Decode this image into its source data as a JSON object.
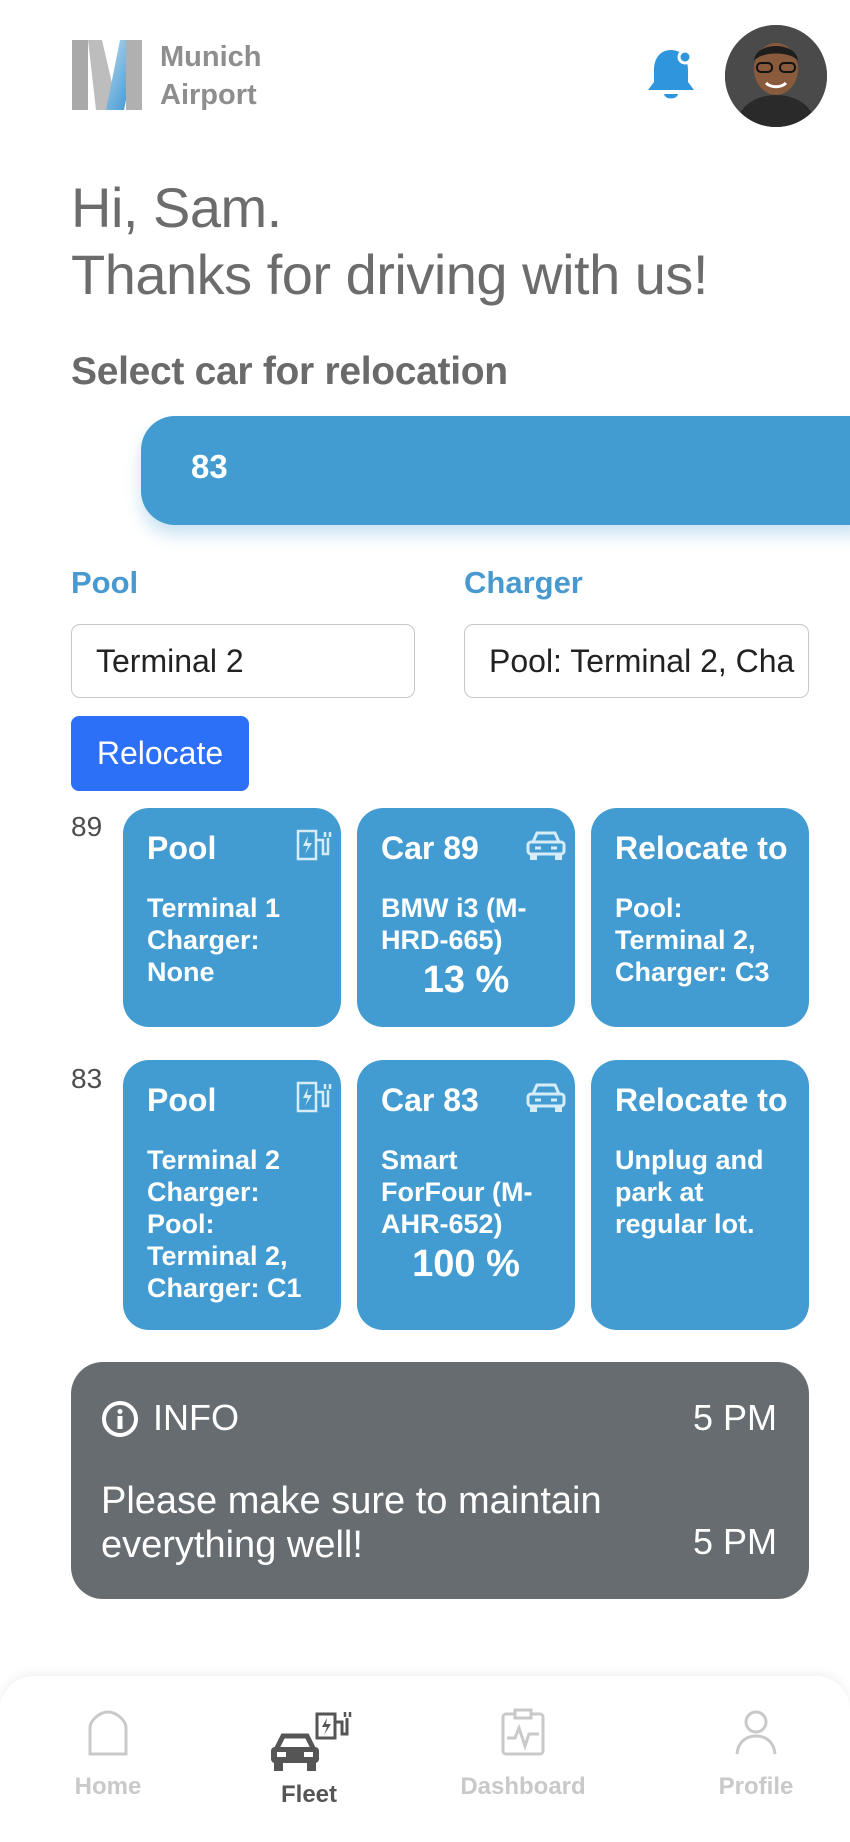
{
  "header": {
    "logo_line1": "Munich",
    "logo_line2": "Airport",
    "notification_icon": "bell-icon",
    "avatar_icon": "user-avatar"
  },
  "greeting": {
    "line1": "Hi, Sam.",
    "line2": "Thanks for driving with us!"
  },
  "section_title": "Select car for relocation",
  "selected_car": "83",
  "form": {
    "pool_label": "Pool",
    "pool_value": "Terminal 2",
    "charger_label": "Charger",
    "charger_value": "Pool: Terminal 2, Cha",
    "relocate_button": "Relocate"
  },
  "rows": [
    {
      "id": "89",
      "pool_card": {
        "title": "Pool",
        "body": "Terminal 1 Charger: None"
      },
      "car_card": {
        "title": "Car 89",
        "body": "BMW i3 (M-HRD-665)",
        "percent": "13 %"
      },
      "relocate_card": {
        "title": "Relocate to",
        "body": "Pool: Terminal 2, Charger: C3"
      }
    },
    {
      "id": "83",
      "pool_card": {
        "title": "Pool",
        "body": "Terminal 2 Charger: Pool: Terminal 2, Charger: C1"
      },
      "car_card": {
        "title": "Car 83",
        "body": "Smart ForFour (M-AHR-652)",
        "percent": "100 %"
      },
      "relocate_card": {
        "title": "Relocate to",
        "body": "Unplug and park at regular lot."
      }
    }
  ],
  "info": {
    "title": "INFO",
    "time1": "5 PM",
    "message": "Please make sure to maintain everything well!",
    "time2": "5 PM"
  },
  "nav": {
    "home": "Home",
    "fleet": "Fleet",
    "dashboard": "Dashboard",
    "profile": "Profile",
    "active": "Fleet"
  },
  "colors": {
    "accent": "#429cd1",
    "primary_button": "#2b70f6",
    "info_bg": "#676c71",
    "text_gray": "#6c6c6c"
  }
}
